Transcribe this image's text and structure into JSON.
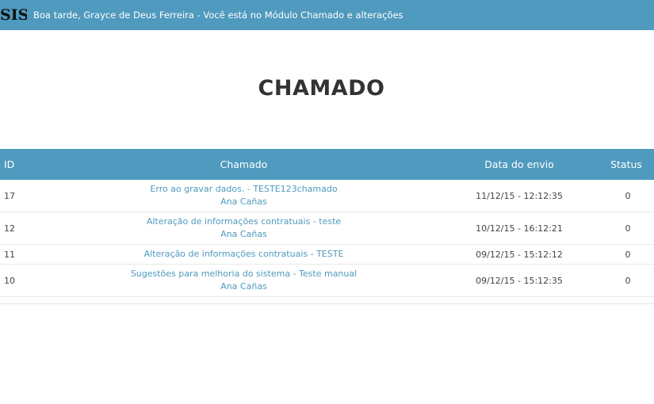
{
  "header": {
    "brand": "SIS",
    "greeting": "Boa tarde, Grayce de Deus Ferreira - Você está no Módulo Chamado e alterações"
  },
  "page_title": "CHAMADO",
  "table": {
    "columns": {
      "id": "ID",
      "chamado": "Chamado",
      "data": "Data do envio",
      "status": "Status"
    },
    "rows": [
      {
        "id": "17",
        "title": "Erro ao gravar dados. - TESTE123chamado",
        "author": "Ana Cañas",
        "date": "11/12/15 - 12:12:35",
        "status": "0"
      },
      {
        "id": "12",
        "title": "Alteração de informações contratuais - teste",
        "author": "Ana Cañas",
        "date": "10/12/15 - 16:12:21",
        "status": "0"
      },
      {
        "id": "11",
        "title": "Alteração de informações contratuais - TESTE",
        "author": "",
        "date": "09/12/15 - 15:12:12",
        "status": "0"
      },
      {
        "id": "10",
        "title": "Sugestões para melhoria do sistema - Teste manual",
        "author": "Ana Cañas",
        "date": "09/12/15 - 15:12:35",
        "status": "0"
      }
    ]
  },
  "colors": {
    "accent": "#4f9abe",
    "title_text": "#333333",
    "body_text": "#444444"
  }
}
